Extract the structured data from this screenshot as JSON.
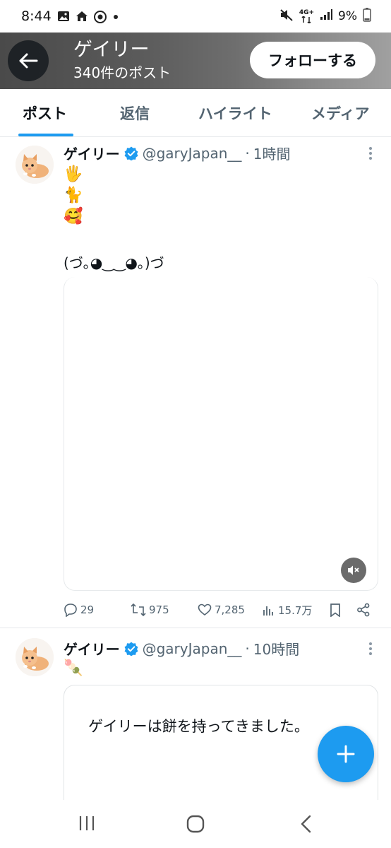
{
  "status_bar": {
    "time": "8:44",
    "network": "4G+",
    "battery": "9%",
    "icons_left": [
      "gallery-icon",
      "home-icon",
      "chrome-icon",
      "dot-icon"
    ],
    "icons_right": [
      "mute-icon",
      "data-arrows-icon",
      "signal-icon",
      "battery-icon"
    ]
  },
  "header": {
    "name": "ゲイリー",
    "post_count": "340件のポスト",
    "follow_label": "フォローする"
  },
  "tabs": [
    {
      "label": "ポスト",
      "active": true
    },
    {
      "label": "返信",
      "active": false
    },
    {
      "label": "ハイライト",
      "active": false
    },
    {
      "label": "メディア",
      "active": false
    }
  ],
  "tweets": [
    {
      "name": "ゲイリー",
      "handle": "@garyJapan__",
      "time": "1時間",
      "emoji_lines": [
        "🖐",
        "🐈",
        "🥰"
      ],
      "text": "(づ｡◕‿‿◕｡)づ",
      "stats": {
        "replies": "29",
        "retweets": "975",
        "likes": "7,285",
        "views": "15.7万"
      }
    },
    {
      "name": "ゲイリー",
      "handle": "@garyJapan__",
      "time": "10時間",
      "emoji_lines": [
        "🍡"
      ],
      "quote_text": "ゲイリーは餅を持ってきました。"
    }
  ],
  "colors": {
    "accent": "#1d9bf0",
    "text": "#0f1419",
    "secondary": "#536471"
  }
}
